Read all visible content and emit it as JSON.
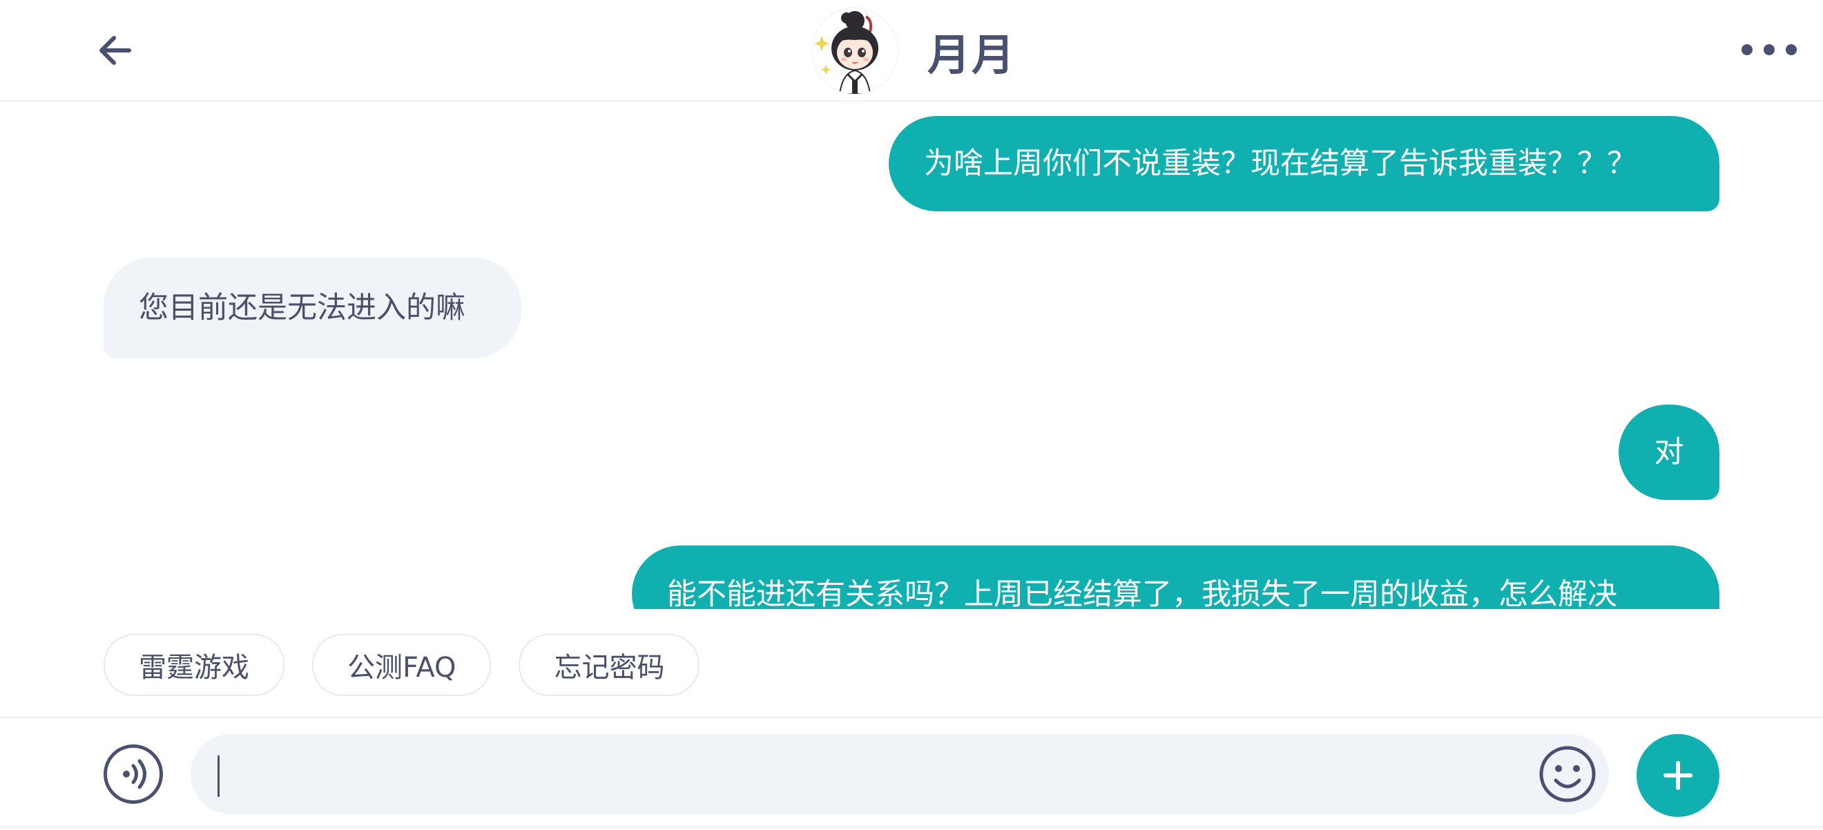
{
  "header": {
    "contact_name": "月月",
    "back_icon": "arrow-left-icon",
    "more_icon": "more-horizontal-icon"
  },
  "messages": [
    {
      "direction": "outgoing",
      "text": "为啥上周你们不说重装？现在结算了告诉我重装？？？"
    },
    {
      "direction": "incoming",
      "text": "您目前还是无法进入的嘛"
    },
    {
      "direction": "outgoing",
      "text": "对"
    },
    {
      "direction": "outgoing",
      "text": "能不能进还有关系吗？上周已经结算了，我损失了一周的收益，怎么解决"
    }
  ],
  "quick_replies": [
    "雷霆游戏",
    "公测FAQ",
    "忘记密码"
  ],
  "input": {
    "value": "",
    "placeholder": "",
    "voice_icon": "voice-icon",
    "emoji_icon": "emoji-icon",
    "plus_icon": "plus-icon"
  },
  "colors": {
    "accent": "#11b0b0",
    "incoming_bubble": "#f0f3f7",
    "text_primary": "#4a4f6a"
  }
}
